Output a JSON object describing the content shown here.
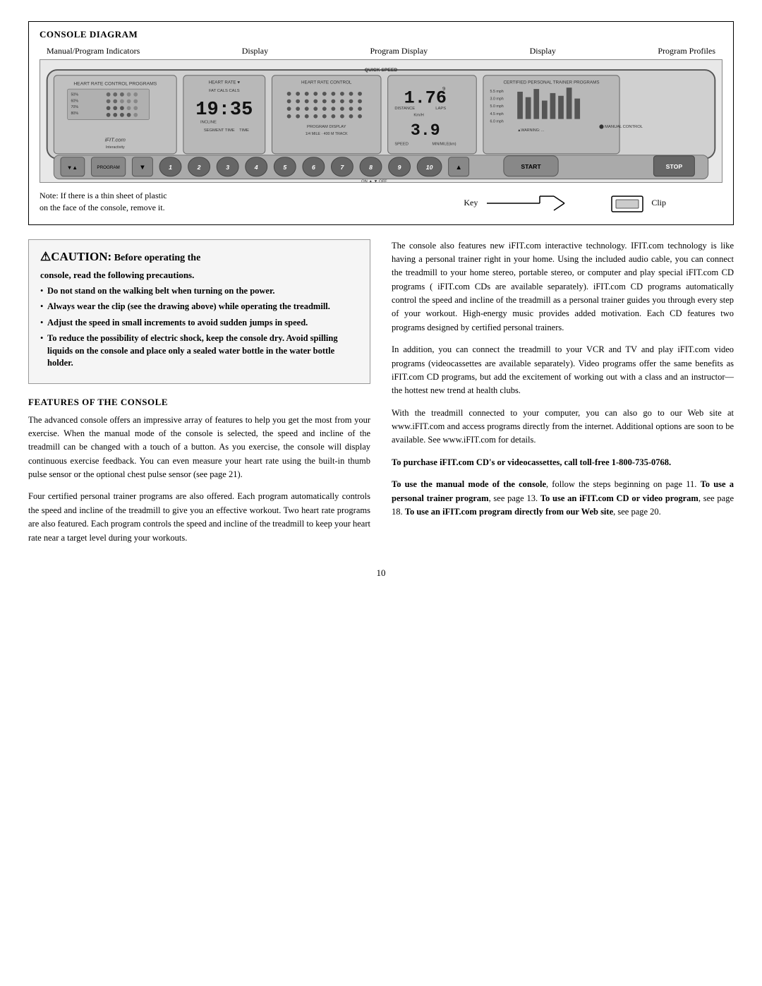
{
  "header": {
    "title": "CONSOLE DIAGRAM"
  },
  "diagram": {
    "labels": [
      {
        "id": "manual-program-indicators",
        "text": "Manual/Program Indicators"
      },
      {
        "id": "display-left",
        "text": "Display"
      },
      {
        "id": "program-display",
        "text": "Program Display"
      },
      {
        "id": "display-right",
        "text": "Display"
      },
      {
        "id": "program-profiles",
        "text": "Program Profiles"
      }
    ],
    "note_line1": "Note: If there is a thin sheet of plastic",
    "note_line2": "on the face of the console, remove it.",
    "key_label": "Key",
    "clip_label": "Clip"
  },
  "caution": {
    "word": "CAUTION:",
    "rest": " Before operating the",
    "bold_line": "console, read the following precautions.",
    "bullets": [
      {
        "bold": "Do not stand on the walking belt when turning on the power."
      },
      {
        "bold": "Always wear the clip (see the drawing above) while operating the treadmill."
      },
      {
        "bold_prefix": "Adjust the speed in small increments to avoid sudden jumps in speed.",
        "rest": ""
      },
      {
        "bold_prefix": "To reduce the possibility of electric shock, keep the console dry. Avoid spilling liquids on the console and place only a sealed water bottle in the water bottle holder.",
        "rest": ""
      }
    ]
  },
  "features": {
    "title": "FEATURES OF THE CONSOLE",
    "paragraphs": [
      "The advanced console offers an impressive array of features to help you get the most from your exercise. When the manual mode of the console is selected, the speed and incline of the treadmill can be changed with a touch of a button. As you exercise, the console will display continuous exercise feedback. You can even measure your heart rate using the built-in thumb pulse sensor or the optional chest pulse sensor (see page 21).",
      "Four certified personal trainer programs are also offered. Each program automatically controls the speed and incline of the treadmill to give you an effective workout. Two heart rate programs are also featured. Each program controls the speed and incline of the treadmill to keep your heart rate near a target level during your workouts."
    ]
  },
  "right_column": {
    "paragraphs": [
      "The console also features new iFIT.com interactive technology. IFIT.com technology is like having a personal trainer right in your home. Using the included audio cable, you can connect the treadmill to your home stereo, portable stereo, or computer and play special iFIT.com CD programs ( iFIT.com CDs are available separately). iFIT.com CD programs automatically control the speed and incline of the treadmill as a personal trainer guides you through every step of your workout. High-energy music provides added motivation. Each CD features two programs designed by certified personal trainers.",
      "In addition, you can connect the treadmill to your VCR and TV and play iFIT.com video programs (videocassettes are available separately). Video programs offer the same benefits as iFIT.com CD programs, but add the excitement of working out with a class and an instructor—the hottest new trend at health clubs.",
      "With the treadmill connected to your computer, you can also go to our Web site at www.iFIT.com and access programs directly from the internet. Additional options are soon to be available. See www.iFIT.com for details."
    ],
    "purchase_bold": "To purchase iFIT.com CD's or videocassettes, call toll-free 1-800-735-0768.",
    "manual_para_bold_prefix": "To use the manual mode of the console",
    "manual_para_rest": ", follow the steps beginning on page 11.",
    "trainer_bold": "To use a personal trainer program",
    "trainer_rest": ", see page 13.",
    "heart_bold": "To use an iFIT.com CD or video program",
    "heart_rest": ", see page 18.",
    "web_bold": "To use an iFIT.com program directly from our Web site",
    "web_rest": ", see page 20."
  },
  "page_number": "10"
}
